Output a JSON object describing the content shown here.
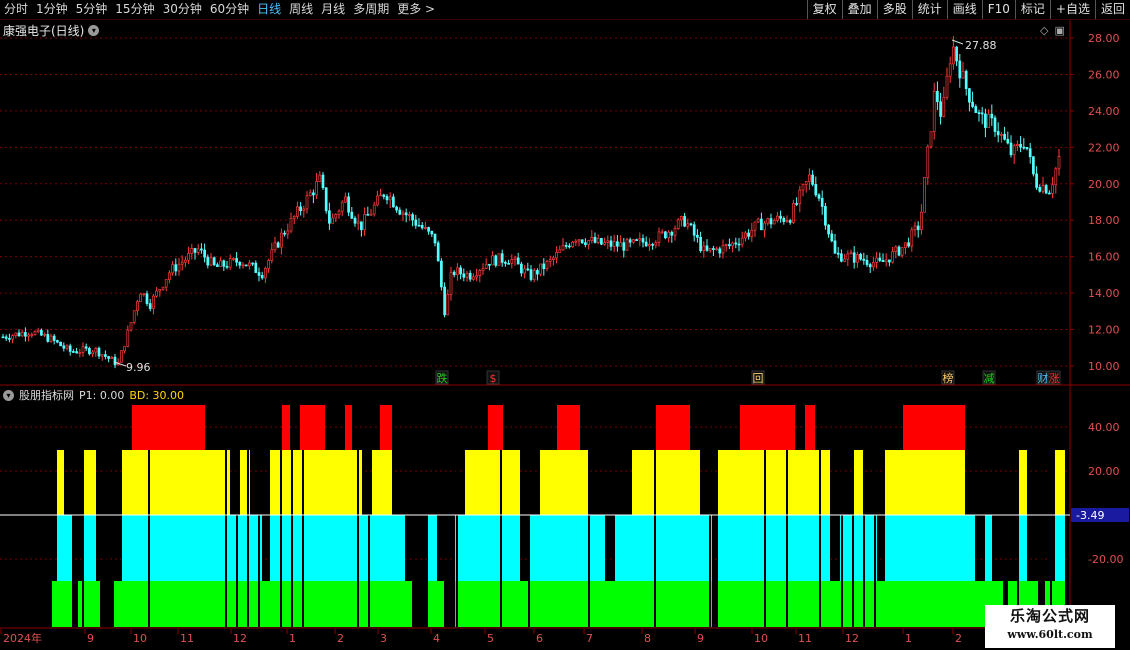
{
  "toolbar": {
    "periods": [
      "分时",
      "1分钟",
      "5分钟",
      "15分钟",
      "30分钟",
      "60分钟",
      "日线",
      "周线",
      "月线",
      "多周期",
      "更多 >"
    ],
    "active_period": "日线",
    "buttons": [
      "复权",
      "叠加",
      "多股",
      "统计",
      "画线",
      "F10",
      "标记",
      "+自选",
      "返回"
    ]
  },
  "main_chart": {
    "title": "康强电子(日线)",
    "y_ticks": [
      "28.00",
      "26.00",
      "24.00",
      "22.00",
      "20.00",
      "18.00",
      "16.00",
      "14.00",
      "12.00",
      "10.00"
    ],
    "y_tick_values": [
      28,
      26,
      24,
      22,
      20,
      18,
      16,
      14,
      12,
      10
    ],
    "high_label": "27.88",
    "low_label": "9.96",
    "signals": [
      {
        "text": "跌",
        "color": "#1fd21f"
      },
      {
        "text": "$",
        "color": "#ff3030"
      },
      {
        "text": "回",
        "color": "#ffcc66"
      },
      {
        "text": "榜",
        "color": "#ffcc66"
      },
      {
        "text": "减",
        "color": "#1fd21f"
      },
      {
        "text": "财",
        "color": "#4fc3ff"
      },
      {
        "text": "涨",
        "color": "#ff3030"
      }
    ]
  },
  "indicator": {
    "name": "股朋指标网",
    "p1": "P1: 0.00",
    "bd": "BD: 30.00",
    "y_ticks": [
      "40.00",
      "20.00",
      "-20.00"
    ],
    "y_tick_values": [
      40,
      20,
      -20
    ],
    "current_label": "3.49",
    "colors": {
      "red": "#ff0000",
      "yellow": "#ffff00",
      "cyan": "#00ffff",
      "green": "#00ff00"
    }
  },
  "x_axis": {
    "labels": [
      "2024年",
      "9",
      "10",
      "11",
      "12",
      "1",
      "2",
      "3",
      "4",
      "5",
      "6",
      "7",
      "8",
      "9",
      "10",
      "11",
      "12",
      "1",
      "2"
    ]
  },
  "watermark": {
    "line1": "乐淘公式网",
    "line2": "www.60lt.com"
  }
}
